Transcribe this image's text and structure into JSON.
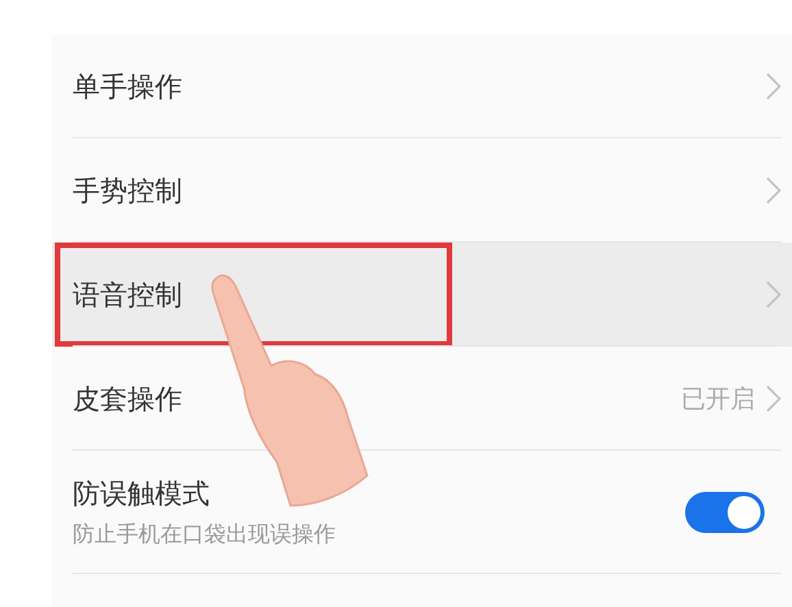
{
  "settings": [
    {
      "kind": "link",
      "label": "单手操作",
      "selected": false
    },
    {
      "kind": "link",
      "label": "手势控制",
      "selected": false
    },
    {
      "kind": "link",
      "label": "语音控制",
      "selected": true,
      "annotated": true
    },
    {
      "kind": "link",
      "label": "皮套操作",
      "value": "已开启",
      "selected": false
    },
    {
      "kind": "toggle",
      "label": "防误触模式",
      "subtitle": "防止手机在口袋出现误操作",
      "on": true,
      "selected": false
    }
  ]
}
